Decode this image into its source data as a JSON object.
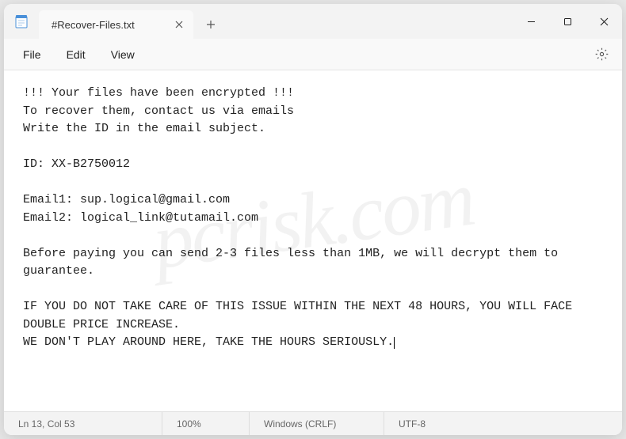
{
  "tab": {
    "title": "#Recover-Files.txt"
  },
  "menu": {
    "file": "File",
    "edit": "Edit",
    "view": "View"
  },
  "document": {
    "lines": [
      "!!! Your files have been encrypted !!!",
      "To recover them, contact us via emails",
      "Write the ID in the email subject.",
      "",
      "ID: XX-B2750012",
      "",
      "Email1: sup.logical@gmail.com",
      "Email2: logical_link@tutamail.com",
      "",
      "Before paying you can send 2-3 files less than 1MB, we will decrypt them to guarantee.",
      "",
      "IF YOU DO NOT TAKE CARE OF THIS ISSUE WITHIN THE NEXT 48 HOURS, YOU WILL FACE DOUBLE PRICE INCREASE.",
      "WE DON'T PLAY AROUND HERE, TAKE THE HOURS SERIOUSLY."
    ]
  },
  "status": {
    "position": "Ln 13, Col 53",
    "zoom": "100%",
    "line_ending": "Windows (CRLF)",
    "encoding": "UTF-8"
  },
  "watermark": "pcrisk.com"
}
